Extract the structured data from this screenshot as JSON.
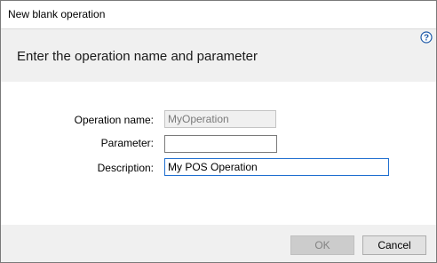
{
  "window": {
    "title": "New blank operation"
  },
  "header": {
    "heading": "Enter the operation name and parameter",
    "help_icon": "help-question-icon"
  },
  "form": {
    "operation_name": {
      "label": "Operation name:",
      "value": "MyOperation",
      "enabled": false
    },
    "parameter": {
      "label": "Parameter:",
      "value": ""
    },
    "description": {
      "label": "Description:",
      "value": "My POS Operation"
    }
  },
  "footer": {
    "ok_label": "OK",
    "ok_enabled": false,
    "cancel_label": "Cancel"
  },
  "colors": {
    "header_band": "#f0f0f0",
    "focus_border": "#1f6fd0",
    "help_icon": "#1e5aa8"
  }
}
